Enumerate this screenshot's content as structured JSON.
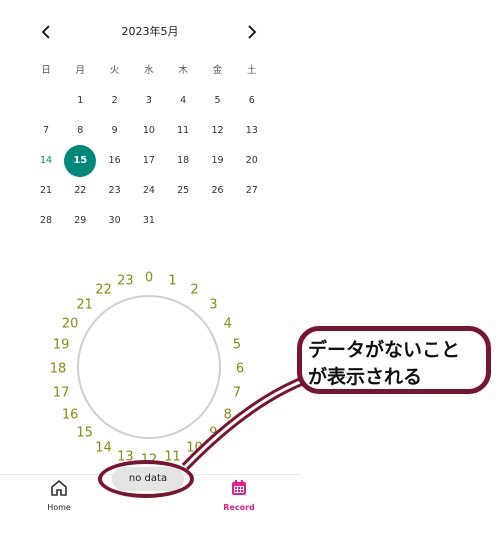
{
  "calendar": {
    "month_title": "2023年5月",
    "weekdays": [
      "日",
      "月",
      "火",
      "水",
      "木",
      "金",
      "土"
    ],
    "days": [
      [
        "",
        "1",
        "2",
        "3",
        "4",
        "5",
        "6"
      ],
      [
        "7",
        "8",
        "9",
        "10",
        "11",
        "12",
        "13"
      ],
      [
        "14",
        "15",
        "16",
        "17",
        "18",
        "19",
        "20"
      ],
      [
        "21",
        "22",
        "23",
        "24",
        "25",
        "26",
        "27"
      ],
      [
        "28",
        "29",
        "30",
        "31",
        "",
        "",
        ""
      ]
    ],
    "selected_day": "15",
    "today_day": "14",
    "accent_color": "#00897b"
  },
  "clock": {
    "hours": [
      "0",
      "1",
      "2",
      "3",
      "4",
      "5",
      "6",
      "7",
      "8",
      "9",
      "10",
      "11",
      "12",
      "13",
      "14",
      "15",
      "16",
      "17",
      "18",
      "19",
      "20",
      "21",
      "22",
      "23"
    ],
    "number_color": "#8a8a10"
  },
  "callout": {
    "line1": "データがないこと",
    "line2": "が表示される",
    "border_color": "#7a1530"
  },
  "toast": {
    "text": "no data"
  },
  "bottom_nav": {
    "items": [
      {
        "label": "Home",
        "icon": "home-icon"
      },
      {
        "label": "Record",
        "icon": "calendar-icon",
        "active": true,
        "color": "#e91e8c"
      }
    ]
  },
  "icons": {
    "prev": "chevron-left-icon",
    "next": "chevron-right-icon"
  }
}
